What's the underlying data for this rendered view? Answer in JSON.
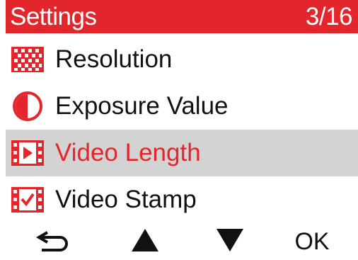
{
  "header": {
    "title": "Settings",
    "page_indicator": "3/16"
  },
  "menu": {
    "items": [
      {
        "label": "Resolution",
        "icon": "resolution-icon",
        "selected": false
      },
      {
        "label": "Exposure Value",
        "icon": "exposure-icon",
        "selected": false
      },
      {
        "label": "Video Length",
        "icon": "video-length-icon",
        "selected": true
      },
      {
        "label": "Video Stamp",
        "icon": "video-stamp-icon",
        "selected": false
      }
    ]
  },
  "footer": {
    "back": "back-arrow-icon",
    "up": "up-triangle-icon",
    "down": "down-triangle-icon",
    "ok_label": "OK"
  },
  "colors": {
    "accent": "#e3262c",
    "selected_bg": "#d3d3d3",
    "text": "#111111"
  }
}
